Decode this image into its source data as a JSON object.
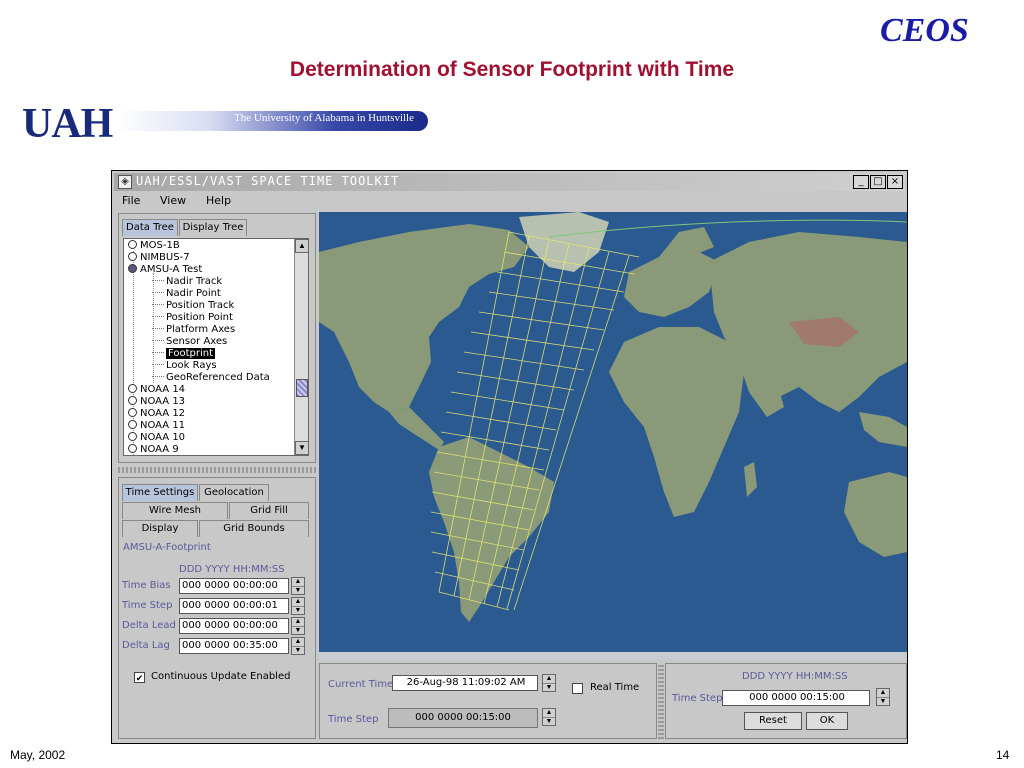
{
  "slide": {
    "brand": "CEOS",
    "title": "Determination of Sensor Footprint with Time",
    "logo_text": "UAH",
    "logo_tagline": "The University of Alabama in Huntsville",
    "footer_date": "May, 2002",
    "page_number": "14"
  },
  "window": {
    "title": "UAH/ESSL/VAST SPACE TIME TOOLKIT",
    "controls": {
      "minimize": "_",
      "maximize": "□",
      "close": "×"
    }
  },
  "menu": [
    "File",
    "View",
    "Help"
  ],
  "tree_panel": {
    "tabs": [
      "Data Tree",
      "Display Tree"
    ],
    "active_tab": 0,
    "items": [
      {
        "label": "MOS-1B",
        "kind": "node",
        "filled": false
      },
      {
        "label": "NIMBUS-7",
        "kind": "node",
        "filled": false
      },
      {
        "label": "AMSU-A Test",
        "kind": "node",
        "filled": true
      },
      {
        "label": "Nadir Track",
        "kind": "leaf"
      },
      {
        "label": "Nadir Point",
        "kind": "leaf"
      },
      {
        "label": "Position Track",
        "kind": "leaf"
      },
      {
        "label": "Position Point",
        "kind": "leaf"
      },
      {
        "label": "Platform Axes",
        "kind": "leaf"
      },
      {
        "label": "Sensor Axes",
        "kind": "leaf"
      },
      {
        "label": "Footprint",
        "kind": "leaf",
        "selected": true
      },
      {
        "label": "Look Rays",
        "kind": "leaf"
      },
      {
        "label": "GeoReferenced Data",
        "kind": "leaf"
      },
      {
        "label": "NOAA 14",
        "kind": "node",
        "filled": false
      },
      {
        "label": "NOAA 13",
        "kind": "node",
        "filled": false
      },
      {
        "label": "NOAA 12",
        "kind": "node",
        "filled": false
      },
      {
        "label": "NOAA 11",
        "kind": "node",
        "filled": false
      },
      {
        "label": "NOAA 10",
        "kind": "node",
        "filled": false
      },
      {
        "label": "NOAA 9",
        "kind": "node",
        "filled": false
      }
    ]
  },
  "settings_panel": {
    "tabs_row1": [
      "Time Settings",
      "Geolocation"
    ],
    "tabs_row2": [
      "Wire Mesh",
      "Grid Fill"
    ],
    "tabs_row3": [
      "Display",
      "Grid Bounds"
    ],
    "object_name": "AMSU-A-Footprint",
    "format_hint": "DDD YYYY HH:MM:SS",
    "fields": [
      {
        "label": "Time Bias",
        "value": "000 0000 00:00:00"
      },
      {
        "label": "Time Step",
        "value": "000 0000 00:00:01"
      },
      {
        "label": "Delta Lead",
        "value": "000 0000 00:00:00"
      },
      {
        "label": "Delta Lag",
        "value": "000 0000 00:35:00"
      }
    ],
    "continuous_update": {
      "label": "Continuous Update Enabled",
      "checked": true
    }
  },
  "time_controls": {
    "current_time_label": "Current Time",
    "current_time": "26-Aug-98 11:09:02 AM",
    "real_time_label": "Real Time",
    "real_time_checked": false,
    "time_step_label": "Time Step",
    "time_step": "000 0000 00:15:00"
  },
  "step_controls": {
    "format_hint": "DDD YYYY HH:MM:SS",
    "time_step_label": "Time Step",
    "time_step": "000 0000 00:15:00",
    "reset_label": "Reset",
    "ok_label": "OK"
  },
  "colors": {
    "ocean": "#2a5a90",
    "land": "#8a9a78",
    "footprint_mesh": "#e8e870",
    "title_red": "#a01030",
    "brand_blue": "#1a1aa8"
  }
}
